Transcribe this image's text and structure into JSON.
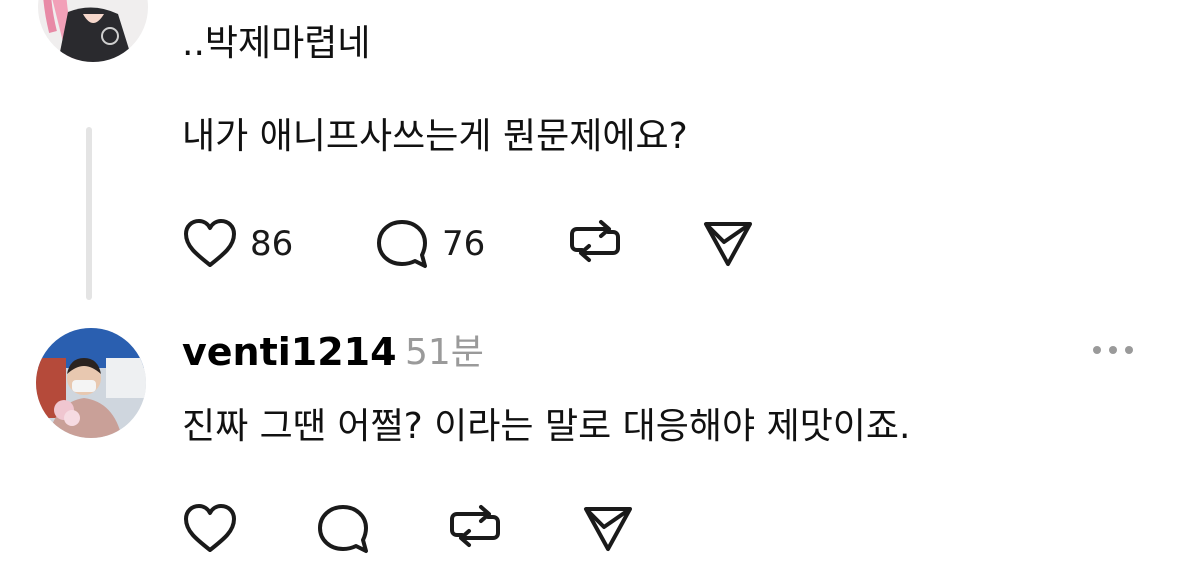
{
  "post1": {
    "reply_text": "..박제마렵네",
    "body_text": "내가 애니프사쓰는게 뭔문제에요?",
    "likes": "86",
    "comments": "76"
  },
  "post2": {
    "username": "venti1214",
    "time": "51분",
    "body_text": "진짜 그땐 어쩔? 이라는 말로 대응해야 제맛이죠."
  },
  "icons": {
    "like": "heart-icon",
    "comment": "speech-bubble-icon",
    "repost": "repost-icon",
    "share": "send-icon",
    "more": "more-horizontal-icon"
  },
  "colors": {
    "text": "#111111",
    "muted": "#9a9a9a",
    "thread_line": "#e4e4e4"
  }
}
